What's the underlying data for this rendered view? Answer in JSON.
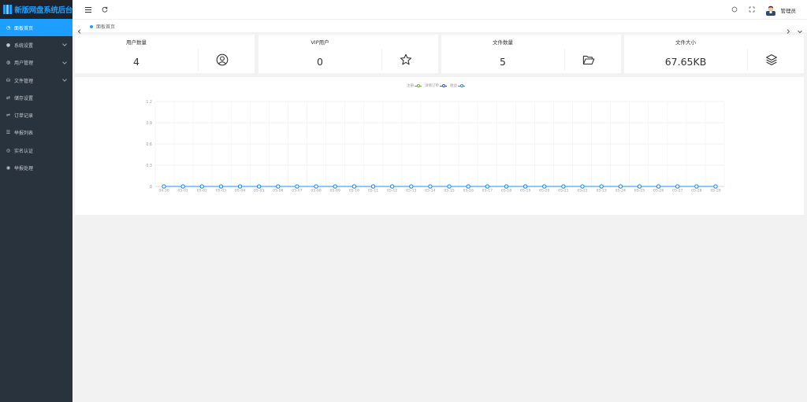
{
  "app": {
    "title": "新版网盘系统后台"
  },
  "sidebar": {
    "items": [
      {
        "label": "面板首页",
        "icon": "dashboard-icon",
        "active": true,
        "expandable": false
      },
      {
        "label": "系统设置",
        "icon": "settings-icon",
        "active": false,
        "expandable": true
      },
      {
        "label": "用户管理",
        "icon": "user-icon",
        "active": false,
        "expandable": true
      },
      {
        "label": "文件管理",
        "icon": "database-icon",
        "active": false,
        "expandable": true
      },
      {
        "label": "储存设置",
        "icon": "storage-icon",
        "active": false,
        "expandable": false
      },
      {
        "label": "订单记录",
        "icon": "order-icon",
        "active": false,
        "expandable": false
      },
      {
        "label": "举报列表",
        "icon": "list-icon",
        "active": false,
        "expandable": false
      },
      {
        "label": "实名认证",
        "icon": "verify-icon",
        "active": false,
        "expandable": false
      },
      {
        "label": "举报处理",
        "icon": "report-icon",
        "active": false,
        "expandable": false
      }
    ]
  },
  "header": {
    "user": "管理员"
  },
  "tabbar": {
    "home": "面板首页"
  },
  "cards": [
    {
      "title": "用户数量",
      "value": "4",
      "icon": "user-circle-icon"
    },
    {
      "title": "VIP用户",
      "value": "0",
      "icon": "star-icon"
    },
    {
      "title": "文件数量",
      "value": "5",
      "icon": "folder-open-icon"
    },
    {
      "title": "文件大小",
      "value": "67.65KB",
      "icon": "layers-icon"
    }
  ],
  "colors": {
    "accent": "#1e9fff",
    "sidebar": "#28333e",
    "logo_bg": "#20222a"
  },
  "chart_data": {
    "type": "line",
    "x": [
      "04-30",
      "05-01",
      "05-02",
      "05-03",
      "05-04",
      "05-05",
      "05-06",
      "05-07",
      "05-08",
      "05-09",
      "05-10",
      "05-11",
      "05-12",
      "05-13",
      "05-14",
      "05-15",
      "05-16",
      "05-17",
      "05-18",
      "05-19",
      "05-20",
      "05-21",
      "05-22",
      "05-23",
      "05-24",
      "05-25",
      "05-26",
      "05-27",
      "05-28",
      "05-29"
    ],
    "series": [
      {
        "name": "注册",
        "color": "#52c41a",
        "values": [
          0,
          0,
          0,
          0,
          0,
          0,
          0,
          0,
          0,
          0,
          0,
          0,
          0,
          0,
          0,
          0,
          0,
          0,
          0,
          0,
          0,
          0,
          0,
          0,
          0,
          0,
          0,
          0,
          0,
          0
        ]
      },
      {
        "name": "详情订单",
        "color": "#2f54eb",
        "values": [
          0,
          0,
          0,
          0,
          0,
          0,
          0,
          0,
          0,
          0,
          0,
          0,
          0,
          0,
          0,
          0,
          0,
          0,
          0,
          0,
          0,
          0,
          0,
          0,
          0,
          0,
          0,
          0,
          0,
          0
        ]
      },
      {
        "name": "收益",
        "color": "#1890ff",
        "values": [
          0,
          0,
          0,
          0,
          0,
          0,
          0,
          0,
          0,
          0,
          0,
          0,
          0,
          0,
          0,
          0,
          0,
          0,
          0,
          0,
          0,
          0,
          0,
          0,
          0,
          0,
          0,
          0,
          0,
          0
        ]
      }
    ],
    "yticks": [
      "0",
      "0.3",
      "0.6",
      "0.9",
      "1.2"
    ],
    "ylim": [
      0,
      1.2
    ],
    "grid": true,
    "legend_position": "top-center"
  }
}
